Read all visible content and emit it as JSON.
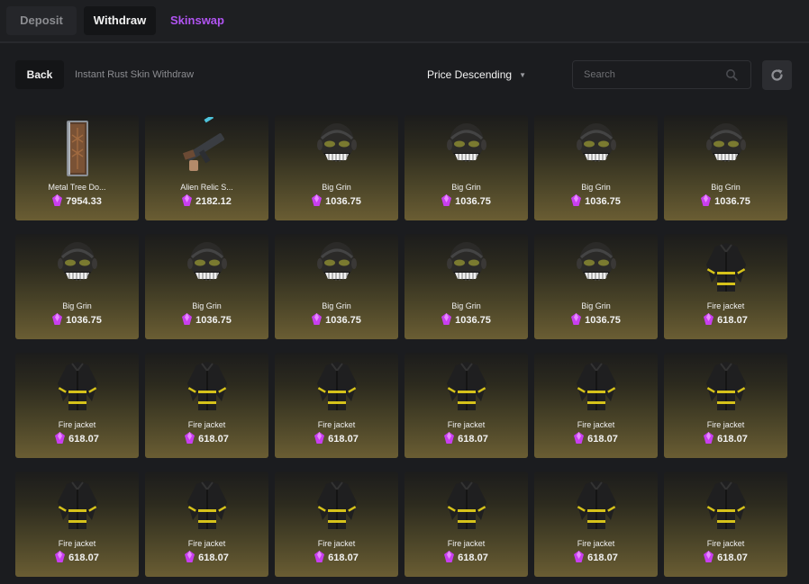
{
  "tabs": [
    {
      "label": "Deposit"
    },
    {
      "label": "Withdraw"
    },
    {
      "label": "Skinswap"
    }
  ],
  "colors": {
    "accent": "#b154f2",
    "gem": "#c93ef0",
    "card_bottom": "#6a5d33"
  },
  "toolbar": {
    "back_label": "Back",
    "subtitle": "Instant Rust Skin Withdraw",
    "sort_label": "Price Descending",
    "search_placeholder": "Search"
  },
  "items": [
    {
      "name": "Metal Tree Do...",
      "price": "7954.33",
      "icon": "metal-tree-door-icon"
    },
    {
      "name": "Alien Relic S...",
      "price": "2182.12",
      "icon": "smg-icon"
    },
    {
      "name": "Big Grin",
      "price": "1036.75",
      "icon": "big-grin-mask-icon"
    },
    {
      "name": "Big Grin",
      "price": "1036.75",
      "icon": "big-grin-mask-icon"
    },
    {
      "name": "Big Grin",
      "price": "1036.75",
      "icon": "big-grin-mask-icon"
    },
    {
      "name": "Big Grin",
      "price": "1036.75",
      "icon": "big-grin-mask-icon"
    },
    {
      "name": "Big Grin",
      "price": "1036.75",
      "icon": "big-grin-mask-icon"
    },
    {
      "name": "Big Grin",
      "price": "1036.75",
      "icon": "big-grin-mask-icon"
    },
    {
      "name": "Big Grin",
      "price": "1036.75",
      "icon": "big-grin-mask-icon"
    },
    {
      "name": "Big Grin",
      "price": "1036.75",
      "icon": "big-grin-mask-icon"
    },
    {
      "name": "Big Grin",
      "price": "1036.75",
      "icon": "big-grin-mask-icon"
    },
    {
      "name": "Fire jacket",
      "price": "618.07",
      "icon": "fire-jacket-icon"
    },
    {
      "name": "Fire jacket",
      "price": "618.07",
      "icon": "fire-jacket-icon"
    },
    {
      "name": "Fire jacket",
      "price": "618.07",
      "icon": "fire-jacket-icon"
    },
    {
      "name": "Fire jacket",
      "price": "618.07",
      "icon": "fire-jacket-icon"
    },
    {
      "name": "Fire jacket",
      "price": "618.07",
      "icon": "fire-jacket-icon"
    },
    {
      "name": "Fire jacket",
      "price": "618.07",
      "icon": "fire-jacket-icon"
    },
    {
      "name": "Fire jacket",
      "price": "618.07",
      "icon": "fire-jacket-icon"
    },
    {
      "name": "Fire jacket",
      "price": "618.07",
      "icon": "fire-jacket-icon"
    },
    {
      "name": "Fire jacket",
      "price": "618.07",
      "icon": "fire-jacket-icon"
    },
    {
      "name": "Fire jacket",
      "price": "618.07",
      "icon": "fire-jacket-icon"
    },
    {
      "name": "Fire jacket",
      "price": "618.07",
      "icon": "fire-jacket-icon"
    },
    {
      "name": "Fire jacket",
      "price": "618.07",
      "icon": "fire-jacket-icon"
    },
    {
      "name": "Fire jacket",
      "price": "618.07",
      "icon": "fire-jacket-icon"
    }
  ]
}
